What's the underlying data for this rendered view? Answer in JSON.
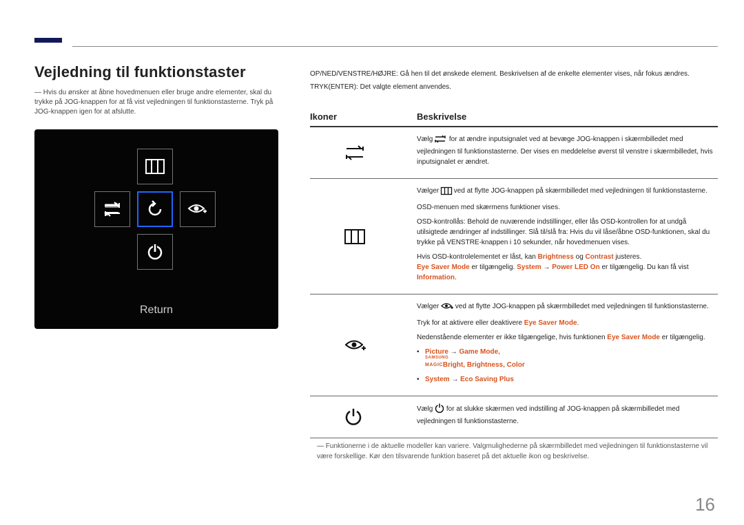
{
  "title": "Vejledning til funktionstaster",
  "left_note": "Hvis du ønsker at åbne hovedmenuen eller bruge andre elementer, skal du trykke på JOG-knappen for at få vist vejledningen til funktionstasterne. Tryk på JOG-knappen igen for at afslutte.",
  "osd_return": "Return",
  "intro1": "OP/NED/VENSTRE/HØJRE: Gå hen til det ønskede element. Beskrivelsen af de enkelte elementer vises, når fokus ændres.",
  "intro2": "TRYK(ENTER): Det valgte element anvendes.",
  "th_icons": "Ikoner",
  "th_desc": "Beskrivelse",
  "row1": {
    "p1a": "Vælg ",
    "p1b": " for at ændre inputsignalet ved at bevæge JOG-knappen i skærmbilledet med vejledningen til funktionstasterne. Der vises en meddelelse øverst til venstre i skærmbilledet, hvis inputsignalet er ændret."
  },
  "row2": {
    "p1a": "Vælger ",
    "p1b": " ved at flytte JOG-knappen på skærmbilledet med vejledningen til funktionstasterne.",
    "p2": "OSD-menuen med skærmens funktioner vises.",
    "p3": "OSD-kontrollås: Behold de nuværende indstillinger, eller lås OSD-kontrollen for at undgå utilsigtede ændringer af indstillinger. Slå til/slå fra: Hvis du vil låse/åbne OSD-funktionen, skal du trykke på VENSTRE-knappen i 10 sekunder, når hovedmenuen vises.",
    "p4a": "Hvis OSD-kontrolelementet er låst, kan ",
    "p4_brightness": "Brightness",
    "p4_og": " og ",
    "p4_contrast": "Contrast",
    "p4b": " justeres.",
    "p5_eye": "Eye Saver Mode",
    "p5a": " er tilgængelig. ",
    "p5_system": "System",
    "p5_arrow": " → ",
    "p5_power": "Power LED On",
    "p5b": " er tilgængelig. Du kan få vist ",
    "p5_info": "Information",
    "p5c": "."
  },
  "row3": {
    "p1a": "Vælger ",
    "p1b": " ved at flytte JOG-knappen på skærmbilledet med vejledningen til funktionstasterne.",
    "p2a": "Tryk for at aktivere eller deaktivere ",
    "p2_eye": "Eye Saver Mode",
    "p2b": ".",
    "p3a": "Nedenstående elementer er ikke tilgængelige, hvis funktionen ",
    "p3_eye": "Eye Saver Mode",
    "p3b": " er tilgængelig.",
    "b1_picture": "Picture",
    "b1_arrow": " → ",
    "b1_game": "Game Mode",
    "b1_sep": ", ",
    "b1_bright": "Bright",
    "b1_brightness": "Brightness",
    "b1_color": "Color",
    "b2_system": "System",
    "b2_arrow": " → ",
    "b2_eco": "Eco Saving Plus"
  },
  "row4": {
    "p1a": "Vælg ",
    "p1b": " for at slukke skærmen ved indstilling af JOG-knappen på skærmbilledet med vejledningen til funktionstasterne."
  },
  "footer": "Funktionerne i de aktuelle modeller kan variere. Valgmulighederne på skærmbilledet med vejledningen til funktionstasterne vil være forskellige. Kør den tilsvarende funktion baseret på det aktuelle ikon og beskrivelse.",
  "page_number": "16",
  "magic_top": "SAMSUNG",
  "magic_bottom": "MAGIC"
}
